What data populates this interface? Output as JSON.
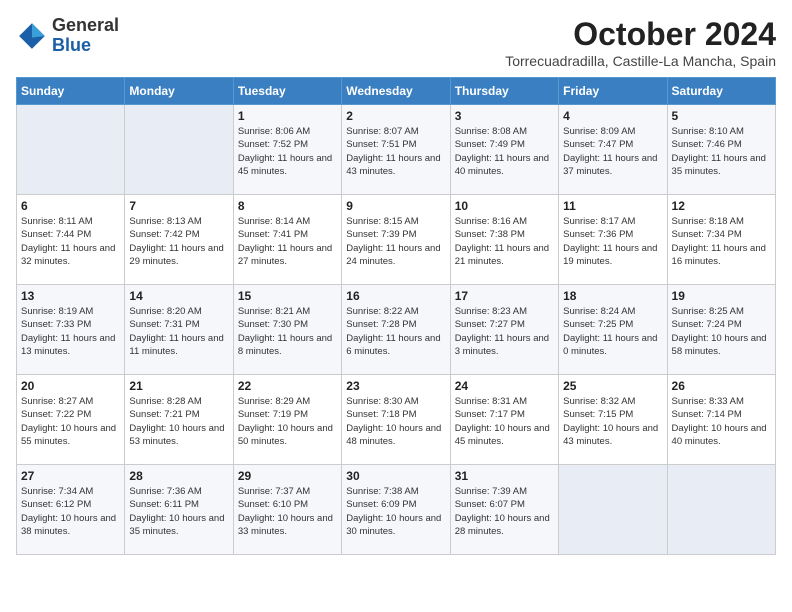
{
  "header": {
    "logo": {
      "general": "General",
      "blue": "Blue"
    },
    "title": "October 2024",
    "location": "Torrecuadradilla, Castille-La Mancha, Spain"
  },
  "weekdays": [
    "Sunday",
    "Monday",
    "Tuesday",
    "Wednesday",
    "Thursday",
    "Friday",
    "Saturday"
  ],
  "weeks": [
    [
      {
        "day": "",
        "empty": true
      },
      {
        "day": "",
        "empty": true
      },
      {
        "day": "1",
        "sunrise": "Sunrise: 8:06 AM",
        "sunset": "Sunset: 7:52 PM",
        "daylight": "Daylight: 11 hours and 45 minutes."
      },
      {
        "day": "2",
        "sunrise": "Sunrise: 8:07 AM",
        "sunset": "Sunset: 7:51 PM",
        "daylight": "Daylight: 11 hours and 43 minutes."
      },
      {
        "day": "3",
        "sunrise": "Sunrise: 8:08 AM",
        "sunset": "Sunset: 7:49 PM",
        "daylight": "Daylight: 11 hours and 40 minutes."
      },
      {
        "day": "4",
        "sunrise": "Sunrise: 8:09 AM",
        "sunset": "Sunset: 7:47 PM",
        "daylight": "Daylight: 11 hours and 37 minutes."
      },
      {
        "day": "5",
        "sunrise": "Sunrise: 8:10 AM",
        "sunset": "Sunset: 7:46 PM",
        "daylight": "Daylight: 11 hours and 35 minutes."
      }
    ],
    [
      {
        "day": "6",
        "sunrise": "Sunrise: 8:11 AM",
        "sunset": "Sunset: 7:44 PM",
        "daylight": "Daylight: 11 hours and 32 minutes."
      },
      {
        "day": "7",
        "sunrise": "Sunrise: 8:13 AM",
        "sunset": "Sunset: 7:42 PM",
        "daylight": "Daylight: 11 hours and 29 minutes."
      },
      {
        "day": "8",
        "sunrise": "Sunrise: 8:14 AM",
        "sunset": "Sunset: 7:41 PM",
        "daylight": "Daylight: 11 hours and 27 minutes."
      },
      {
        "day": "9",
        "sunrise": "Sunrise: 8:15 AM",
        "sunset": "Sunset: 7:39 PM",
        "daylight": "Daylight: 11 hours and 24 minutes."
      },
      {
        "day": "10",
        "sunrise": "Sunrise: 8:16 AM",
        "sunset": "Sunset: 7:38 PM",
        "daylight": "Daylight: 11 hours and 21 minutes."
      },
      {
        "day": "11",
        "sunrise": "Sunrise: 8:17 AM",
        "sunset": "Sunset: 7:36 PM",
        "daylight": "Daylight: 11 hours and 19 minutes."
      },
      {
        "day": "12",
        "sunrise": "Sunrise: 8:18 AM",
        "sunset": "Sunset: 7:34 PM",
        "daylight": "Daylight: 11 hours and 16 minutes."
      }
    ],
    [
      {
        "day": "13",
        "sunrise": "Sunrise: 8:19 AM",
        "sunset": "Sunset: 7:33 PM",
        "daylight": "Daylight: 11 hours and 13 minutes."
      },
      {
        "day": "14",
        "sunrise": "Sunrise: 8:20 AM",
        "sunset": "Sunset: 7:31 PM",
        "daylight": "Daylight: 11 hours and 11 minutes."
      },
      {
        "day": "15",
        "sunrise": "Sunrise: 8:21 AM",
        "sunset": "Sunset: 7:30 PM",
        "daylight": "Daylight: 11 hours and 8 minutes."
      },
      {
        "day": "16",
        "sunrise": "Sunrise: 8:22 AM",
        "sunset": "Sunset: 7:28 PM",
        "daylight": "Daylight: 11 hours and 6 minutes."
      },
      {
        "day": "17",
        "sunrise": "Sunrise: 8:23 AM",
        "sunset": "Sunset: 7:27 PM",
        "daylight": "Daylight: 11 hours and 3 minutes."
      },
      {
        "day": "18",
        "sunrise": "Sunrise: 8:24 AM",
        "sunset": "Sunset: 7:25 PM",
        "daylight": "Daylight: 11 hours and 0 minutes."
      },
      {
        "day": "19",
        "sunrise": "Sunrise: 8:25 AM",
        "sunset": "Sunset: 7:24 PM",
        "daylight": "Daylight: 10 hours and 58 minutes."
      }
    ],
    [
      {
        "day": "20",
        "sunrise": "Sunrise: 8:27 AM",
        "sunset": "Sunset: 7:22 PM",
        "daylight": "Daylight: 10 hours and 55 minutes."
      },
      {
        "day": "21",
        "sunrise": "Sunrise: 8:28 AM",
        "sunset": "Sunset: 7:21 PM",
        "daylight": "Daylight: 10 hours and 53 minutes."
      },
      {
        "day": "22",
        "sunrise": "Sunrise: 8:29 AM",
        "sunset": "Sunset: 7:19 PM",
        "daylight": "Daylight: 10 hours and 50 minutes."
      },
      {
        "day": "23",
        "sunrise": "Sunrise: 8:30 AM",
        "sunset": "Sunset: 7:18 PM",
        "daylight": "Daylight: 10 hours and 48 minutes."
      },
      {
        "day": "24",
        "sunrise": "Sunrise: 8:31 AM",
        "sunset": "Sunset: 7:17 PM",
        "daylight": "Daylight: 10 hours and 45 minutes."
      },
      {
        "day": "25",
        "sunrise": "Sunrise: 8:32 AM",
        "sunset": "Sunset: 7:15 PM",
        "daylight": "Daylight: 10 hours and 43 minutes."
      },
      {
        "day": "26",
        "sunrise": "Sunrise: 8:33 AM",
        "sunset": "Sunset: 7:14 PM",
        "daylight": "Daylight: 10 hours and 40 minutes."
      }
    ],
    [
      {
        "day": "27",
        "sunrise": "Sunrise: 7:34 AM",
        "sunset": "Sunset: 6:12 PM",
        "daylight": "Daylight: 10 hours and 38 minutes."
      },
      {
        "day": "28",
        "sunrise": "Sunrise: 7:36 AM",
        "sunset": "Sunset: 6:11 PM",
        "daylight": "Daylight: 10 hours and 35 minutes."
      },
      {
        "day": "29",
        "sunrise": "Sunrise: 7:37 AM",
        "sunset": "Sunset: 6:10 PM",
        "daylight": "Daylight: 10 hours and 33 minutes."
      },
      {
        "day": "30",
        "sunrise": "Sunrise: 7:38 AM",
        "sunset": "Sunset: 6:09 PM",
        "daylight": "Daylight: 10 hours and 30 minutes."
      },
      {
        "day": "31",
        "sunrise": "Sunrise: 7:39 AM",
        "sunset": "Sunset: 6:07 PM",
        "daylight": "Daylight: 10 hours and 28 minutes."
      },
      {
        "day": "",
        "empty": true
      },
      {
        "day": "",
        "empty": true
      }
    ]
  ]
}
